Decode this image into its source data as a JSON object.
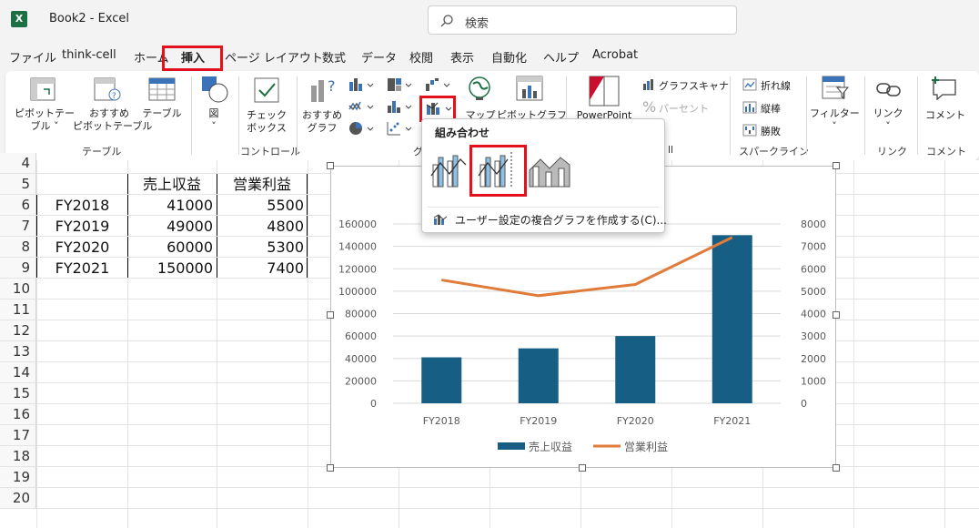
{
  "app": {
    "icon": "X",
    "title": "Book2  -  Excel"
  },
  "search": {
    "placeholder": "検索"
  },
  "menu": {
    "tabs": [
      "ファイル",
      "think-cell",
      "ホーム",
      "挿入",
      "ページ レイアウト",
      "数式",
      "データ",
      "校閲",
      "表示",
      "自動化",
      "ヘルプ",
      "Acrobat"
    ],
    "active": "挿入"
  },
  "ribbon": {
    "pivot_table": "ピボットテー\nブル ˅",
    "recommended_pivot": "おすすめ\nピボットテーブル",
    "table": "テーブル",
    "illustrations": "図\n˅",
    "checkbox": "チェック\nボックス",
    "recommended_charts": "おすすめ\nグラフ",
    "map": "マップ",
    "pivot_chart": "ピボットグラフ",
    "powerpoint": "PowerPoint",
    "graph_scanner": "グラフスキャナ",
    "percent": "パーセント",
    "sparkline_line": "折れ線",
    "sparkline_column": "縦棒",
    "sparkline_winloss": "勝敗",
    "filter": "フィルター\n˅",
    "link": "リンク\n˅",
    "comment": "コメント",
    "groups": {
      "table": "テーブル",
      "control": "コントロール",
      "chart": "グ",
      "thinkcell": "ll",
      "sparkline": "スパークライン",
      "link": "リンク",
      "comment": "コメント"
    }
  },
  "dropdown": {
    "title": "組み合わせ",
    "custom": "ユーザー設定の複合グラフを作成する(C)..."
  },
  "sheet": {
    "rows": [
      "4",
      "5",
      "6",
      "7",
      "8",
      "9",
      "10",
      "11",
      "12",
      "13",
      "14",
      "15",
      "16",
      "17",
      "18",
      "19",
      "20"
    ],
    "headers": [
      "売上収益",
      "営業利益"
    ],
    "table_rows": [
      {
        "label": "FY2018",
        "sales": "41000",
        "profit": "5500"
      },
      {
        "label": "FY2019",
        "sales": "49000",
        "profit": "4800"
      },
      {
        "label": "FY2020",
        "sales": "60000",
        "profit": "5300"
      },
      {
        "label": "FY2021",
        "sales": "150000",
        "profit": "7400"
      }
    ]
  },
  "chart_data": {
    "type": "bar",
    "categories": [
      "FY2018",
      "FY2019",
      "FY2020",
      "FY2021"
    ],
    "series": [
      {
        "name": "売上収益",
        "type": "bar",
        "axis": "left",
        "values": [
          41000,
          49000,
          60000,
          150000
        ],
        "color": "#165e83"
      },
      {
        "name": "営業利益",
        "type": "line",
        "axis": "right",
        "values": [
          5500,
          4800,
          5300,
          7400
        ],
        "color": "#e07b39"
      }
    ],
    "ylim_left": [
      0,
      160000
    ],
    "ylim_right": [
      0,
      8000
    ],
    "left_ticks": [
      "0",
      "20000",
      "40000",
      "60000",
      "80000",
      "100000",
      "120000",
      "140000",
      "160000"
    ],
    "right_ticks": [
      "0",
      "1000",
      "2000",
      "3000",
      "4000",
      "5000",
      "6000",
      "7000",
      "8000"
    ],
    "legend": "bottom",
    "grid": true
  },
  "colors": {
    "accent": "#1d7044",
    "highlight": "#e3101e",
    "bar": "#165e83",
    "line": "#e07b39"
  }
}
